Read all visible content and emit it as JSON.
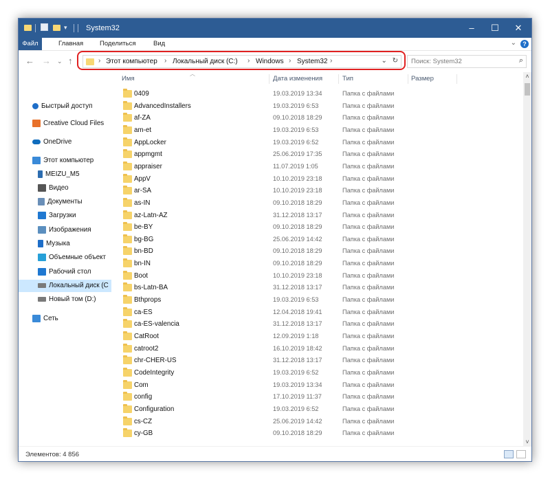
{
  "window": {
    "title": "System32"
  },
  "ribbon": {
    "tabs": [
      "Файл",
      "Главная",
      "Поделиться",
      "Вид"
    ]
  },
  "address": {
    "crumbs": [
      "Этот компьютер",
      "Локальный диск (C:)",
      "Windows",
      "System32"
    ],
    "search_placeholder": "Поиск: System32"
  },
  "columns": {
    "name": "Имя",
    "date": "Дата изменения",
    "type": "Тип",
    "size": "Размер"
  },
  "sidebar": {
    "items": [
      {
        "label": "Быстрый доступ",
        "icon": "star-icon",
        "color": "#1e6ec8"
      },
      {
        "label": "Creative Cloud Files",
        "icon": "creative-cloud-icon",
        "color": "#e8712a"
      },
      {
        "label": "OneDrive",
        "icon": "cloud-icon",
        "color": "#0f6cbd"
      },
      {
        "label": "Этот компьютер",
        "icon": "computer-icon",
        "color": "#3a8ad8"
      },
      {
        "label": "MEIZU_M5",
        "icon": "phone-icon",
        "color": "#2d6db0"
      },
      {
        "label": "Видео",
        "icon": "video-icon",
        "color": "#555555"
      },
      {
        "label": "Документы",
        "icon": "documents-icon",
        "color": "#6a8fb8"
      },
      {
        "label": "Загрузки",
        "icon": "download-icon",
        "color": "#1f78d1"
      },
      {
        "label": "Изображения",
        "icon": "pictures-icon",
        "color": "#5b8fbf"
      },
      {
        "label": "Музыка",
        "icon": "music-icon",
        "color": "#1e6ec8"
      },
      {
        "label": "Объемные объект",
        "icon": "3d-objects-icon",
        "color": "#27a0d8"
      },
      {
        "label": "Рабочий стол",
        "icon": "desktop-icon",
        "color": "#1f78d1"
      },
      {
        "label": "Локальный диск (C",
        "icon": "drive-icon",
        "color": "#7a7a7a"
      },
      {
        "label": "Новый том (D:)",
        "icon": "drive-icon",
        "color": "#7a7a7a"
      },
      {
        "label": "Сеть",
        "icon": "network-icon",
        "color": "#3a8ad8"
      }
    ]
  },
  "folder_type": "Папка с файлами",
  "files": [
    {
      "name": "0409",
      "date": "19.03.2019 13:34"
    },
    {
      "name": "AdvancedInstallers",
      "date": "19.03.2019 6:53"
    },
    {
      "name": "af-ZA",
      "date": "09.10.2018 18:29"
    },
    {
      "name": "am-et",
      "date": "19.03.2019 6:53"
    },
    {
      "name": "AppLocker",
      "date": "19.03.2019 6:52"
    },
    {
      "name": "appmgmt",
      "date": "25.06.2019 17:35"
    },
    {
      "name": "appraiser",
      "date": "11.07.2019 1:05"
    },
    {
      "name": "AppV",
      "date": "10.10.2019 23:18"
    },
    {
      "name": "ar-SA",
      "date": "10.10.2019 23:18"
    },
    {
      "name": "as-IN",
      "date": "09.10.2018 18:29"
    },
    {
      "name": "az-Latn-AZ",
      "date": "31.12.2018 13:17"
    },
    {
      "name": "be-BY",
      "date": "09.10.2018 18:29"
    },
    {
      "name": "bg-BG",
      "date": "25.06.2019 14:42"
    },
    {
      "name": "bn-BD",
      "date": "09.10.2018 18:29"
    },
    {
      "name": "bn-IN",
      "date": "09.10.2018 18:29"
    },
    {
      "name": "Boot",
      "date": "10.10.2019 23:18"
    },
    {
      "name": "bs-Latn-BA",
      "date": "31.12.2018 13:17"
    },
    {
      "name": "Bthprops",
      "date": "19.03.2019 6:53"
    },
    {
      "name": "ca-ES",
      "date": "12.04.2018 19:41"
    },
    {
      "name": "ca-ES-valencia",
      "date": "31.12.2018 13:17"
    },
    {
      "name": "CatRoot",
      "date": "12.09.2019 1:18"
    },
    {
      "name": "catroot2",
      "date": "16.10.2019 18:42"
    },
    {
      "name": "chr-CHER-US",
      "date": "31.12.2018 13:17"
    },
    {
      "name": "CodeIntegrity",
      "date": "19.03.2019 6:52"
    },
    {
      "name": "Com",
      "date": "19.03.2019 13:34"
    },
    {
      "name": "config",
      "date": "17.10.2019 11:37"
    },
    {
      "name": "Configuration",
      "date": "19.03.2019 6:52"
    },
    {
      "name": "cs-CZ",
      "date": "25.06.2019 14:42"
    },
    {
      "name": "cy-GB",
      "date": "09.10.2018 18:29"
    }
  ],
  "status": {
    "count": "Элементов: 4 856"
  }
}
